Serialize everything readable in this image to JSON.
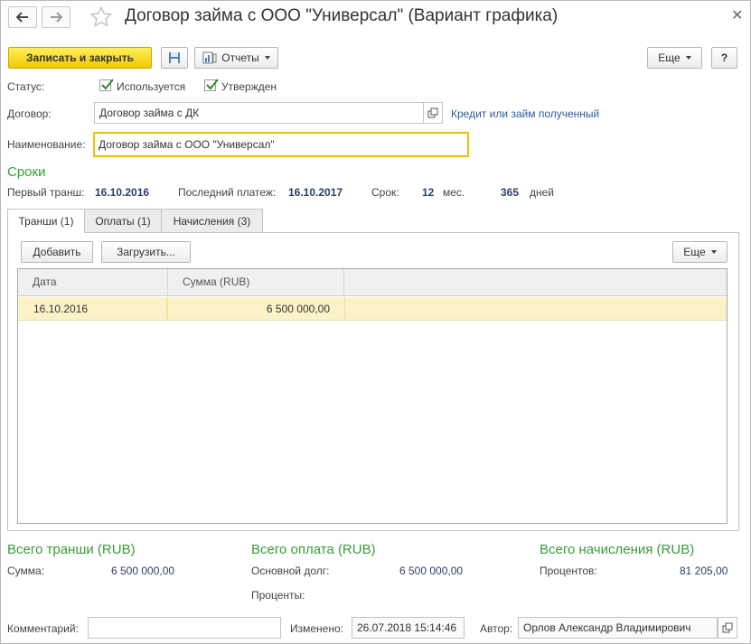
{
  "window": {
    "title": "Договор займа с ООО \"Универсал\" (Вариант графика)"
  },
  "toolbar": {
    "save_close": "Записать и закрыть",
    "reports": "Отчеты",
    "more": "Еще",
    "help": "?"
  },
  "status": {
    "label": "Статус:",
    "used_label": "Используется",
    "used_checked": true,
    "approved_label": "Утвержден",
    "approved_checked": true
  },
  "contract": {
    "label": "Договор:",
    "value": "Договор займа с ДК",
    "type_link": "Кредит или займ полученный"
  },
  "name": {
    "label": "Наименование:",
    "value": "Договор займа с ООО \"Универсал\""
  },
  "terms": {
    "heading": "Сроки",
    "first_tranche_label": "Первый транш:",
    "first_tranche_value": "16.10.2016",
    "last_payment_label": "Последний платеж:",
    "last_payment_value": "16.10.2017",
    "term_label": "Срок:",
    "months_value": "12",
    "months_unit": "мес.",
    "days_value": "365",
    "days_unit": "дней"
  },
  "tabs": [
    {
      "label": "Транши (1)",
      "active": true
    },
    {
      "label": "Оплаты (1)",
      "active": false
    },
    {
      "label": "Начисления (3)",
      "active": false
    }
  ],
  "table_toolbar": {
    "add": "Добавить",
    "load": "Загрузить...",
    "more": "Еще"
  },
  "table": {
    "columns": [
      "Дата",
      "Сумма (RUB)"
    ],
    "rows": [
      {
        "date": "16.10.2016",
        "sum": "6 500 000,00"
      }
    ]
  },
  "totals": {
    "tranches_heading": "Всего транши (RUB)",
    "tranches_sum_label": "Сумма:",
    "tranches_sum_value": "6 500 000,00",
    "payments_heading": "Всего оплата (RUB)",
    "principal_label": "Основной долг:",
    "principal_value": "6 500 000,00",
    "interest_label": "Проценты:",
    "accruals_heading": "Всего начисления (RUB)",
    "percents_label": "Процентов:",
    "percents_value": "81 205,00"
  },
  "footer": {
    "comment_label": "Комментарий:",
    "comment_value": "",
    "changed_label": "Изменено:",
    "changed_value": "26.07.2018 15:14:46",
    "author_label": "Автор:",
    "author_value": "Орлов Александр Владимирович"
  },
  "colors": {
    "accent_green": "#3a9a3a",
    "primary_button": "#f5d20f",
    "selected_row": "#fbf3c7",
    "focus_border": "#f0c000"
  }
}
